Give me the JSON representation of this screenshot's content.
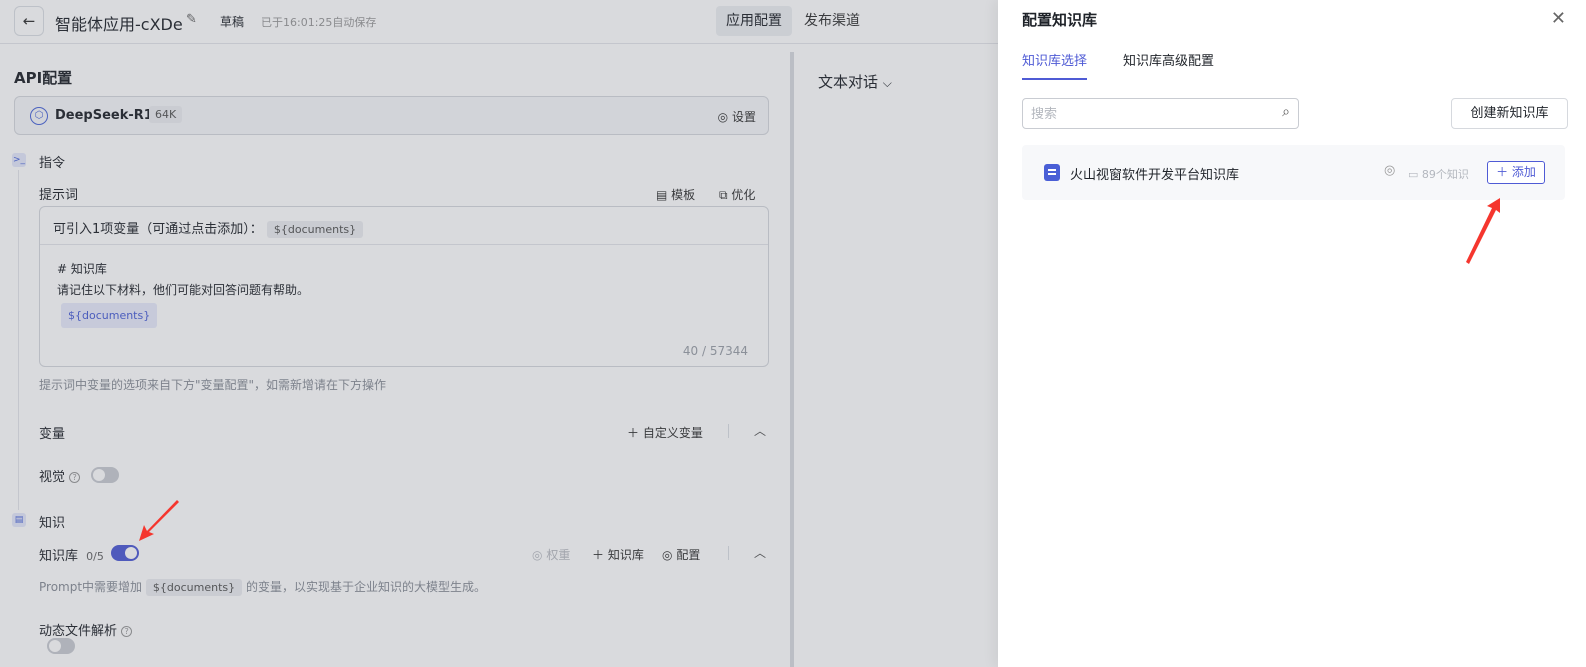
{
  "topbar": {
    "app_title": "智能体应用-cXDe",
    "draft_label": "草稿",
    "autosave_text": "已于16:01:25自动保存",
    "tabs": [
      {
        "label": "应用配置",
        "active": true
      },
      {
        "label": "发布渠道",
        "active": false
      }
    ]
  },
  "api": {
    "title": "API配置",
    "model_name": "DeepSeek-R1",
    "model_context": "64K",
    "settings_label": "设置"
  },
  "instruction": {
    "section_label": "指令",
    "prompt_label": "提示词",
    "template_label": "模板",
    "optimize_label": "优化",
    "variable_hint": "可引入1项变量（可通过点击添加）：",
    "variable_chip": "${documents}",
    "prompt_line1": "# 知识库",
    "prompt_line2": "请记住以下材料，他们可能对回答问题有帮助。",
    "prompt_var": "${documents}",
    "char_count": "40 / 57344",
    "footer_hint": "提示词中变量的选项来自下方\"变量配置\"，如需新增请在下方操作"
  },
  "variables": {
    "label": "变量",
    "custom_var_label": "自定义变量",
    "vision_label": "视觉",
    "vision_enabled": false
  },
  "knowledge": {
    "section_label": "知识",
    "kb_label": "知识库",
    "kb_count": "0/5",
    "kb_enabled": true,
    "weight_label": "权重",
    "add_kb_label": "知识库",
    "config_label": "配置",
    "hint_pre": "Prompt中需要增加",
    "hint_var": "${documents}",
    "hint_post": "的变量，以实现基于企业知识的大模型生成。",
    "dynamic_parse_label": "动态文件解析",
    "dynamic_parse_enabled": false
  },
  "chat": {
    "mode_label": "文本对话"
  },
  "drawer": {
    "title": "配置知识库",
    "tabs": [
      {
        "label": "知识库选择",
        "active": true
      },
      {
        "label": "知识库高级配置",
        "active": false
      }
    ],
    "search_placeholder": "搜索",
    "create_button": "创建新知识库",
    "kb_items": [
      {
        "name": "火山视窗软件开发平台知识库",
        "count": "89个知识",
        "add_label": "添加"
      }
    ]
  },
  "colors": {
    "accent": "#4f5bd5",
    "annotation_arrow": "#f5362e"
  }
}
